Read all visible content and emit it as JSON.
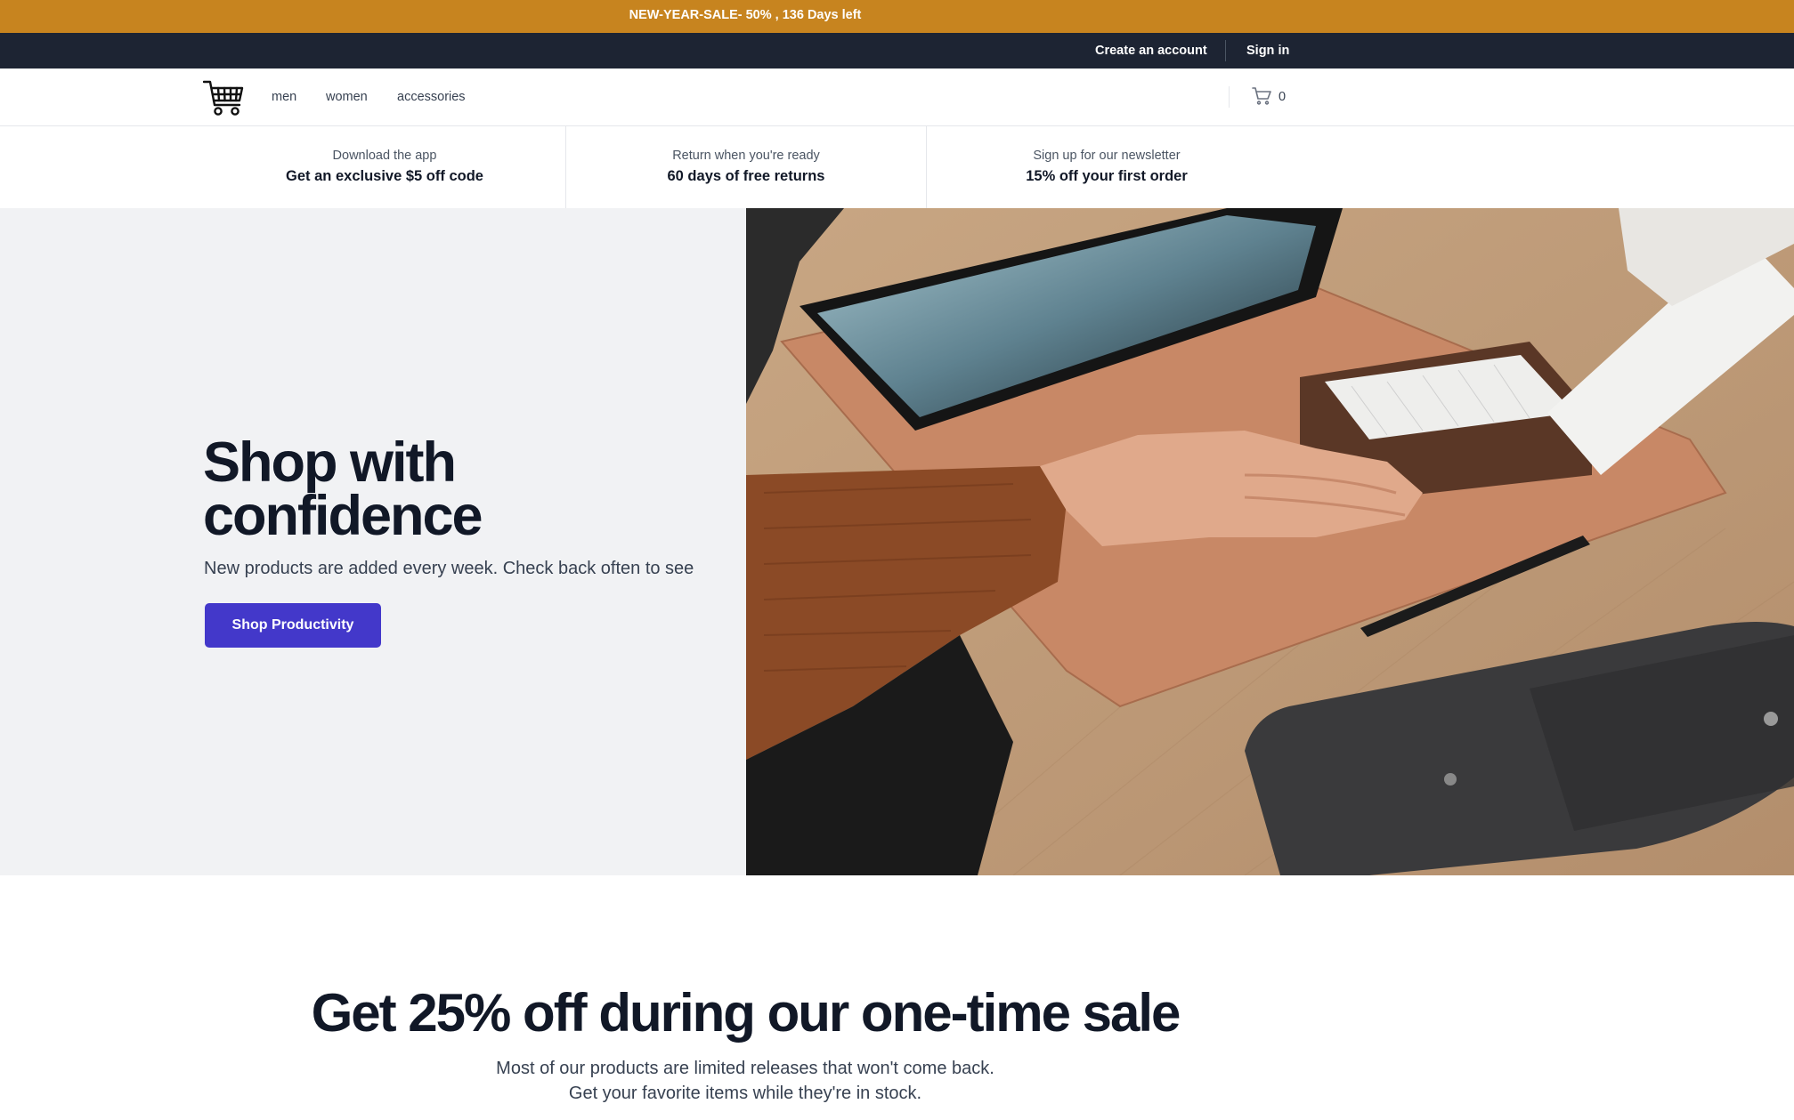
{
  "promo": {
    "text": "NEW-YEAR-SALE- 50% , 136 Days left",
    "color": "#c7841f"
  },
  "account_bar": {
    "create_account": "Create an account",
    "sign_in": "Sign in"
  },
  "nav": {
    "logo_icon": "shopping-cart-icon",
    "links": [
      "men",
      "women",
      "accessories"
    ],
    "cart_icon": "cart-icon",
    "cart_count": "0"
  },
  "perks": [
    {
      "sub": "Download the app",
      "main": "Get an exclusive $5 off code"
    },
    {
      "sub": "Return when you're ready",
      "main": "60 days of free returns"
    },
    {
      "sub": "Sign up for our newsletter",
      "main": "15% off your first order"
    }
  ],
  "hero": {
    "title_line1": "Shop with",
    "title_line2": "confidence",
    "subtitle": "New products are added every week. Check back often to see",
    "button": "Shop Productivity",
    "button_color": "#4338ca",
    "image": "desk-workspace-photo"
  },
  "sale": {
    "title": "Get 25% off during our one-time sale",
    "line1": "Most of our products are limited releases that won't come back.",
    "line2": "Get your favorite items while they're in stock."
  }
}
